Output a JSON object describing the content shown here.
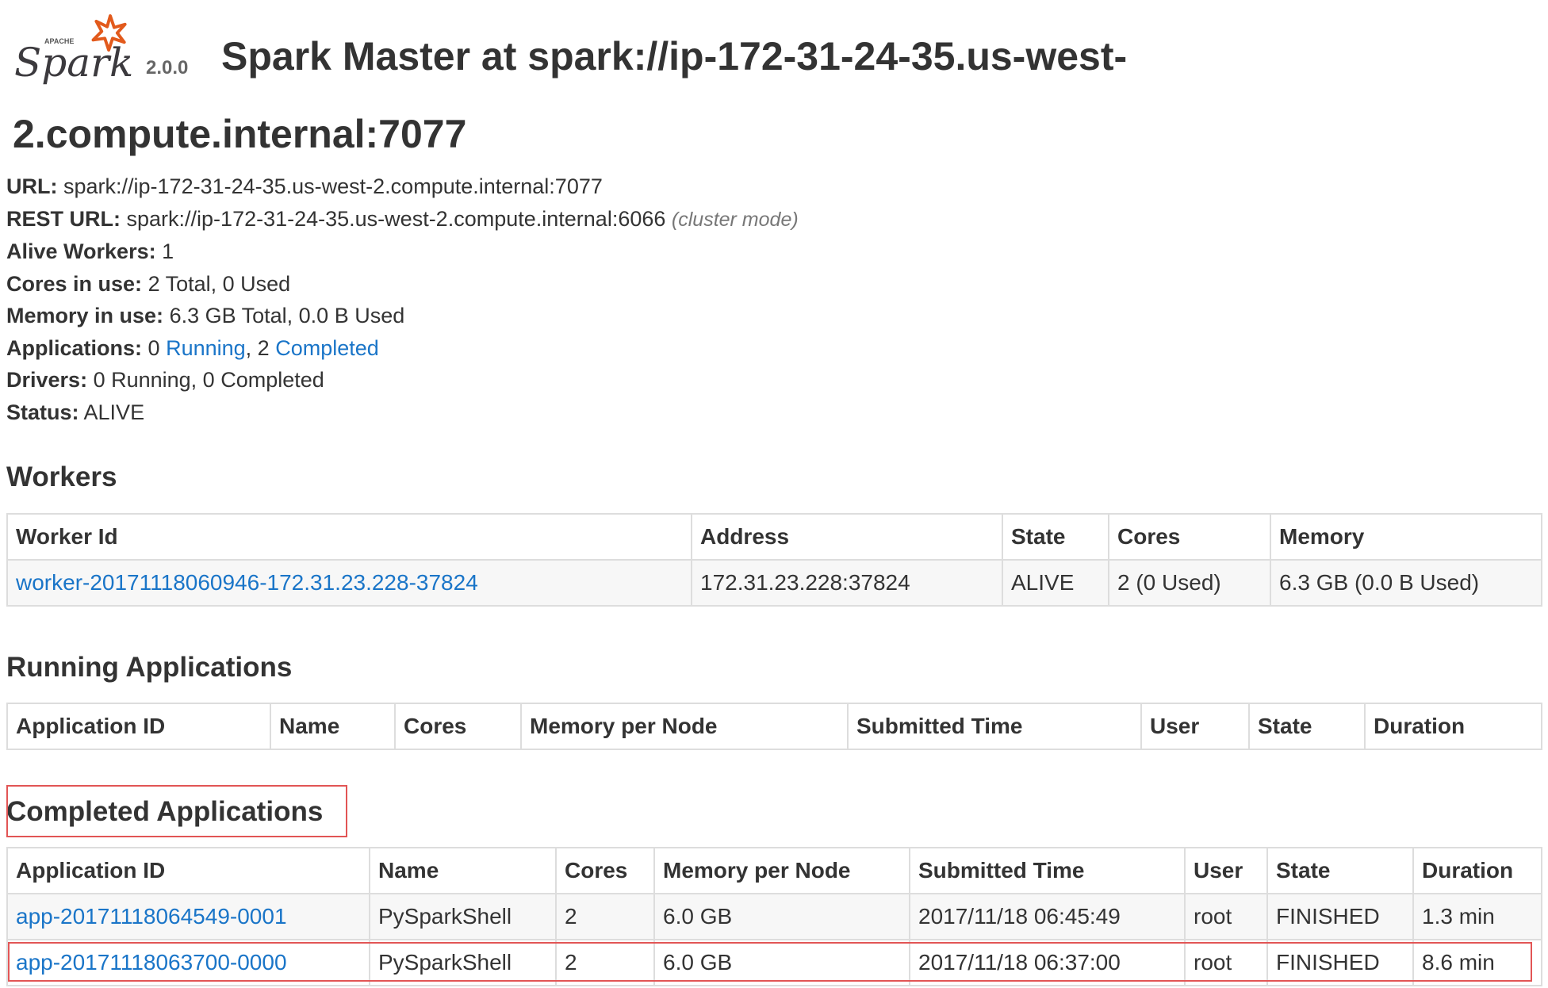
{
  "header": {
    "logo_top_text": "APACHE",
    "logo_text": "Spark",
    "version": "2.0.0",
    "title": "Spark Master at spark://ip-172-31-24-35.us-west-2.compute.internal:7077"
  },
  "info": {
    "url_label": "URL:",
    "url_value": "spark://ip-172-31-24-35.us-west-2.compute.internal:7077",
    "rest_label": "REST URL:",
    "rest_value": "spark://ip-172-31-24-35.us-west-2.compute.internal:6066",
    "rest_hint": "(cluster mode)",
    "workers_label": "Alive Workers:",
    "workers_value": "1",
    "cores_label": "Cores in use:",
    "cores_value": "2 Total, 0 Used",
    "memory_label": "Memory in use:",
    "memory_value": "6.3 GB Total, 0.0 B Used",
    "apps_label": "Applications:",
    "apps_running_count": "0",
    "apps_running_link": "Running",
    "apps_completed_count": "2",
    "apps_completed_link": "Completed",
    "drivers_label": "Drivers:",
    "drivers_value": "0 Running, 0 Completed",
    "status_label": "Status:",
    "status_value": "ALIVE"
  },
  "workers": {
    "heading": "Workers",
    "columns": [
      "Worker Id",
      "Address",
      "State",
      "Cores",
      "Memory"
    ],
    "rows": [
      [
        "worker-20171118060946-172.31.23.228-37824",
        "172.31.23.228:37824",
        "ALIVE",
        "2 (0 Used)",
        "6.3 GB (0.0 B Used)"
      ]
    ]
  },
  "running": {
    "heading": "Running Applications",
    "columns": [
      "Application ID",
      "Name",
      "Cores",
      "Memory per Node",
      "Submitted Time",
      "User",
      "State",
      "Duration"
    ]
  },
  "completed": {
    "heading": "Completed Applications",
    "columns": [
      "Application ID",
      "Name",
      "Cores",
      "Memory per Node",
      "Submitted Time",
      "User",
      "State",
      "Duration"
    ],
    "rows": [
      [
        "app-20171118064549-0001",
        "PySparkShell",
        "2",
        "6.0 GB",
        "2017/11/18 06:45:49",
        "root",
        "FINISHED",
        "1.3 min"
      ],
      [
        "app-20171118063700-0000",
        "PySparkShell",
        "2",
        "6.0 GB",
        "2017/11/18 06:37:00",
        "root",
        "FINISHED",
        "8.6 min"
      ]
    ]
  },
  "colors": {
    "link": "#1a75c8",
    "highlight": "#e25555",
    "logo_star": "#e25a1c"
  }
}
